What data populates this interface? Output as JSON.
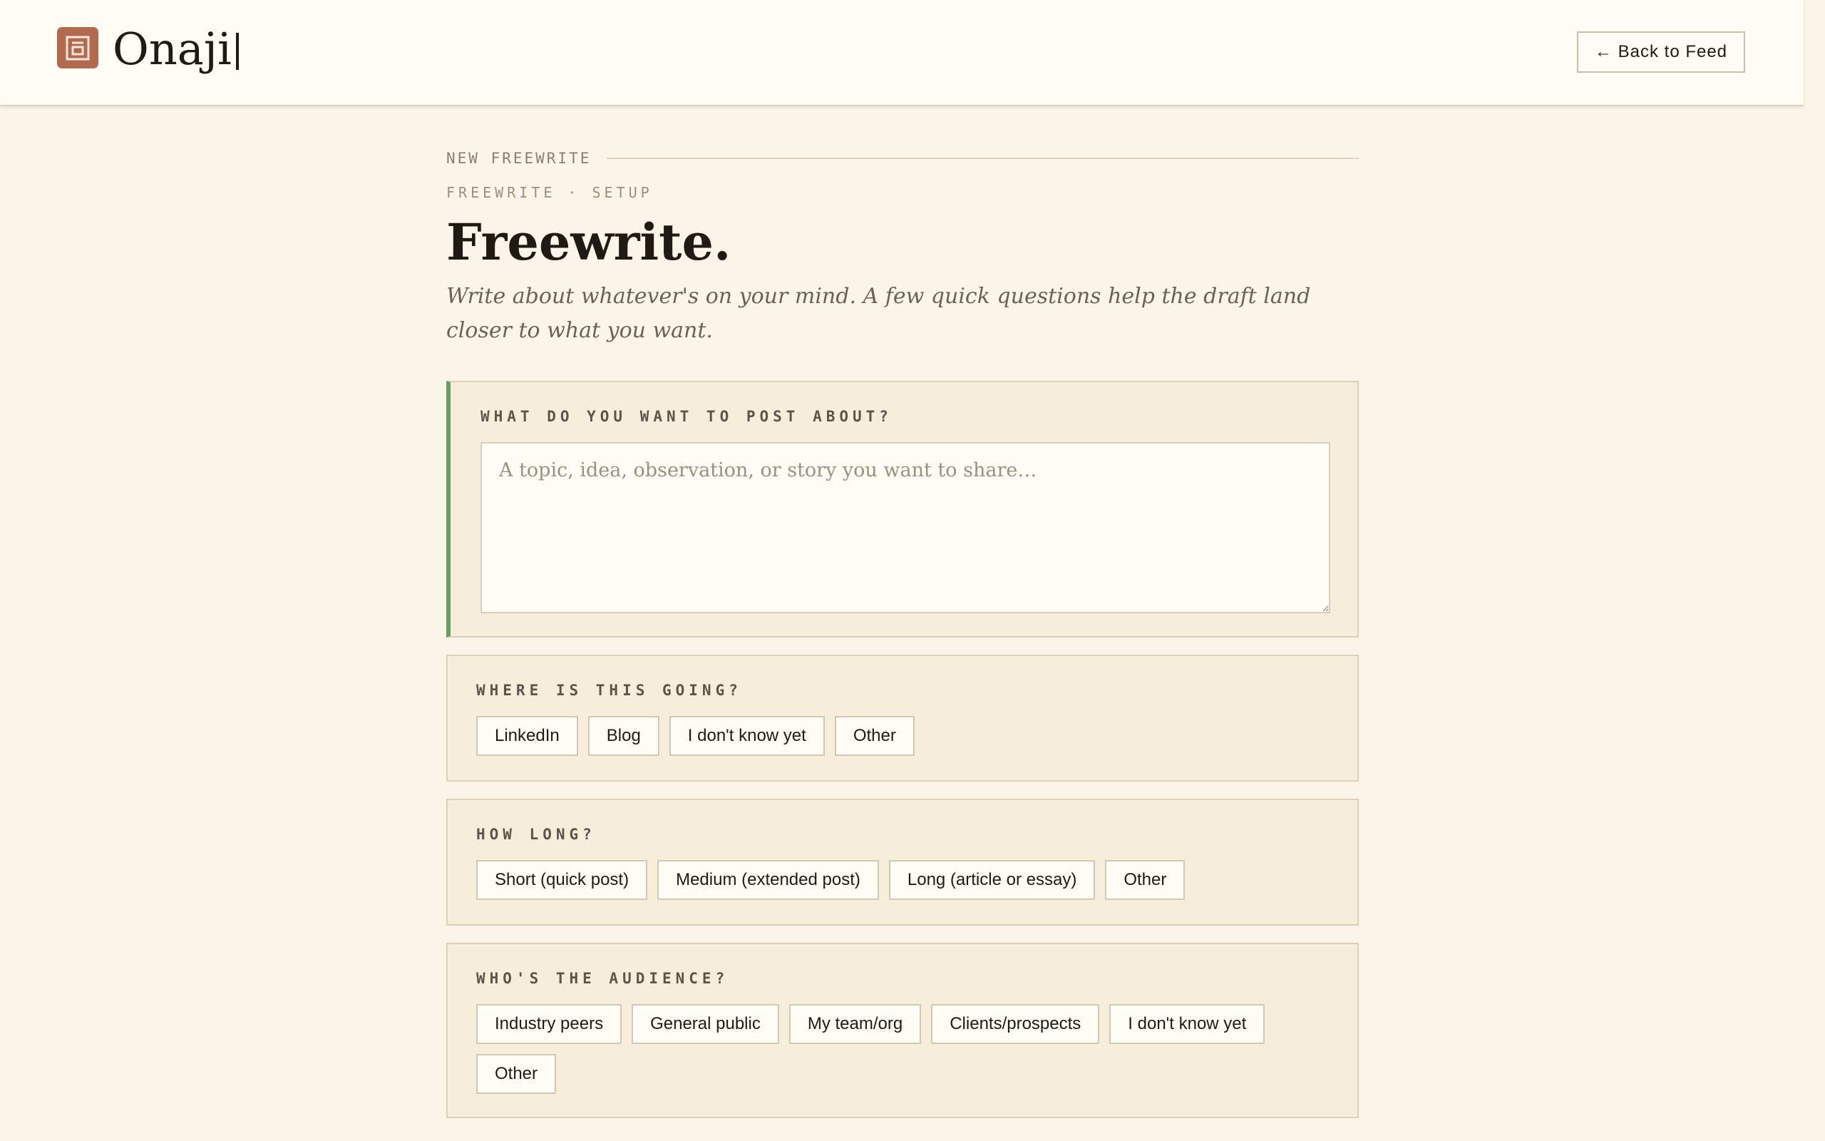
{
  "header": {
    "brand": "Onaji",
    "logo_icon": "kanji-logo-icon",
    "back_label": "← Back to Feed"
  },
  "page": {
    "kicker": "NEW FREEWRITE",
    "eyebrow": "FREEWRITE · SETUP",
    "title": "Freewrite.",
    "subtitle": "Write about whatever's on your mind. A few quick questions help the draft land closer to what you want."
  },
  "topic": {
    "label": "WHAT DO YOU WANT TO POST ABOUT?",
    "placeholder": "A topic, idea, observation, or story you want to share…",
    "value": ""
  },
  "destination": {
    "label": "WHERE IS THIS GOING?",
    "options": [
      "LinkedIn",
      "Blog",
      "I don't know yet",
      "Other"
    ]
  },
  "length": {
    "label": "HOW LONG?",
    "options": [
      "Short (quick post)",
      "Medium (extended post)",
      "Long (article or essay)",
      "Other"
    ]
  },
  "audience": {
    "label": "WHO'S THE AUDIENCE?",
    "options": [
      "Industry peers",
      "General public",
      "My team/org",
      "Clients/prospects",
      "I don't know yet",
      "Other"
    ]
  },
  "colors": {
    "accent_green": "#6b9a62",
    "logo_bg": "#b26a4f",
    "background": "#faf5e8"
  }
}
